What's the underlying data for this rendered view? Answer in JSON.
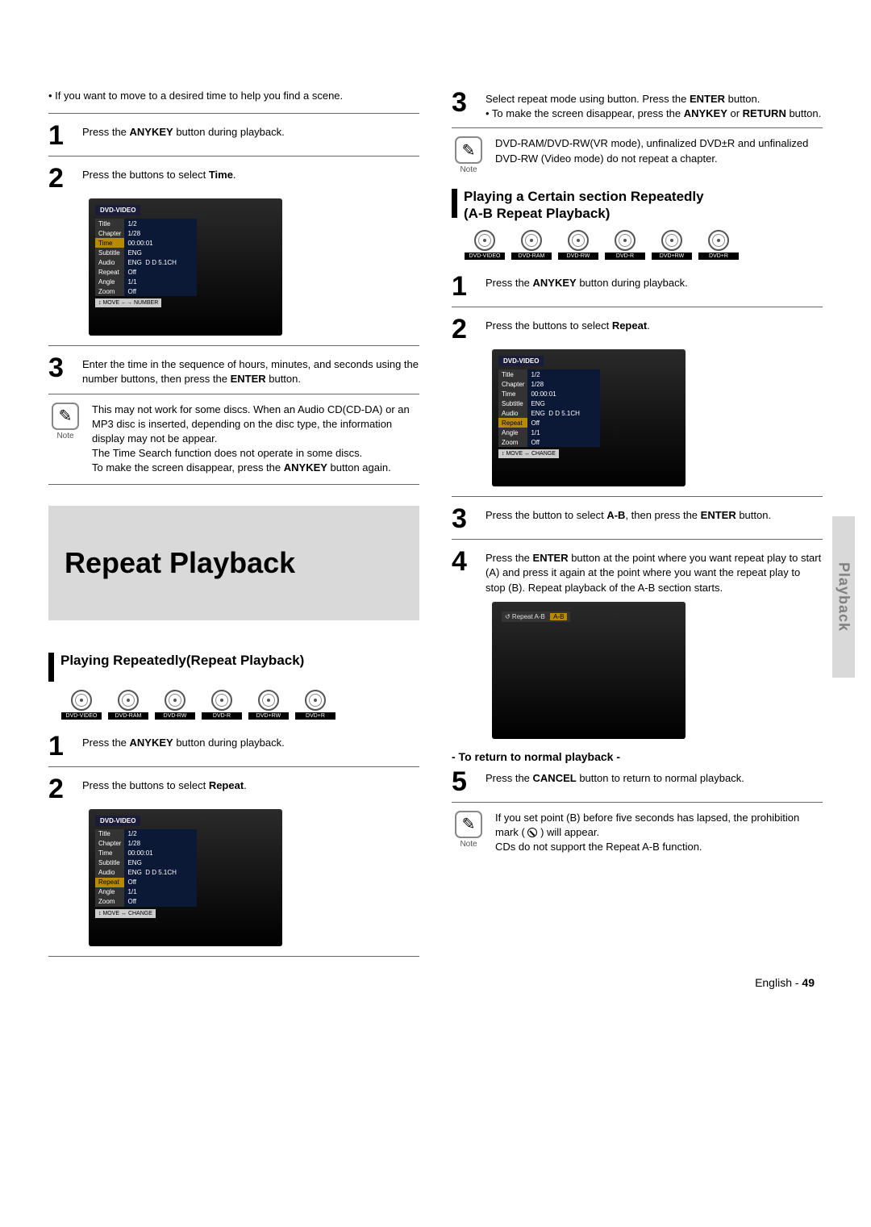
{
  "sidetab": "Playback",
  "left": {
    "intro": "• If you want to move to a desired time to help you find a scene.",
    "step1_pre": "Press the ",
    "step1_b1": "ANYKEY",
    "step1_post": " button during playback.",
    "step2_pre": "Press the          buttons to select ",
    "step2_b1": "Time",
    "step2_post": ".",
    "osd1": {
      "heading": "DVD-VIDEO",
      "rows": [
        {
          "k": "Title",
          "v": "1/2"
        },
        {
          "k": "Chapter",
          "v": "1/28"
        },
        {
          "k": "Time",
          "v": "00:00:01"
        },
        {
          "k": "Subtitle",
          "v": "ENG"
        },
        {
          "k": "Audio",
          "v": "ENG  D D 5.1CH"
        },
        {
          "k": "Repeat",
          "v": "Off"
        },
        {
          "k": "Angle",
          "v": "1/1"
        },
        {
          "k": "Zoom",
          "v": "Off"
        }
      ],
      "highlight_key": "Time",
      "foot": "↕ MOVE  ←→ NUMBER"
    },
    "step3": "Enter the time in the sequence of hours, minutes, and seconds using the number buttons, then press the ",
    "step3_b1": "ENTER",
    "step3_post": " button.",
    "note_label": "Note",
    "note1_a": "This may not work for some discs. When an Audio CD(CD-DA) or an MP3 disc is inserted, depending on the disc type, the information display may not be appear.",
    "note1_b": "The Time Search function does not operate in some discs.",
    "note1_c_pre": "To make the screen disappear, press the ",
    "note1_c_b": "ANYKEY",
    "note1_c_post": " button again.",
    "big_title": "Repeat Playback",
    "sectionA": "Playing Repeatedly(Repeat Playback)",
    "discs": [
      "DVD-VIDEO",
      "DVD-RAM",
      "DVD-RW",
      "DVD-R",
      "DVD+RW",
      "DVD+R"
    ],
    "stepA1_pre": "Press the ",
    "stepA1_b": "ANYKEY",
    "stepA1_post": " button during playback.",
    "stepA2_pre": "Press the          buttons to select ",
    "stepA2_b": "Repeat",
    "stepA2_post": ".",
    "osd2": {
      "heading": "DVD-VIDEO",
      "rows": [
        {
          "k": "Title",
          "v": "1/2"
        },
        {
          "k": "Chapter",
          "v": "1/28"
        },
        {
          "k": "Time",
          "v": "00:00:01"
        },
        {
          "k": "Subtitle",
          "v": "ENG"
        },
        {
          "k": "Audio",
          "v": "ENG  D D 5.1CH"
        },
        {
          "k": "Repeat",
          "v": "Off"
        },
        {
          "k": "Angle",
          "v": "1/1"
        },
        {
          "k": "Zoom",
          "v": "Off"
        }
      ],
      "highlight_key": "Repeat",
      "foot": "↕ MOVE  ↔ CHANGE"
    }
  },
  "right": {
    "step3_pre": "Select repeat mode using          button. Press the ",
    "step3_b1": "ENTER",
    "step3_post": " button.",
    "step3_li_pre": "• To make the screen disappear, press the ",
    "step3_li_b": "ANYKEY",
    "step3_li_mid": " or ",
    "step3_li_b2": "RETURN",
    "step3_li_post": " button.",
    "noteR1": "DVD-RAM/DVD-RW(VR mode), unfinalized DVD±R and unfinalized DVD-RW (Video mode) do not repeat a chapter.",
    "sectionB_l1": "Playing a Certain section Repeatedly",
    "sectionB_l2": "(A-B Repeat Playback)",
    "discs": [
      "DVD-VIDEO",
      "DVD-RAM",
      "DVD-RW",
      "DVD-R",
      "DVD+RW",
      "DVD+R"
    ],
    "stepB1_pre": "Press the ",
    "stepB1_b": "ANYKEY",
    "stepB1_post": " button during playback.",
    "stepB2_pre": "Press the          buttons to select ",
    "stepB2_b": "Repeat",
    "stepB2_post": ".",
    "osd3": {
      "heading": "DVD-VIDEO",
      "rows": [
        {
          "k": "Title",
          "v": "1/2"
        },
        {
          "k": "Chapter",
          "v": "1/28"
        },
        {
          "k": "Time",
          "v": "00:00:01"
        },
        {
          "k": "Subtitle",
          "v": "ENG"
        },
        {
          "k": "Audio",
          "v": "ENG  D D 5.1CH"
        },
        {
          "k": "Repeat",
          "v": "Off"
        },
        {
          "k": "Angle",
          "v": "1/1"
        },
        {
          "k": "Zoom",
          "v": "Off"
        }
      ],
      "highlight_key": "Repeat",
      "foot": "↕ MOVE  ↔ CHANGE"
    },
    "stepB3_pre": "Press the          button to select ",
    "stepB3_b": "A-B",
    "stepB3_mid": ", then press the ",
    "stepB3_b2": "ENTER",
    "stepB3_post": " button.",
    "stepB4_pre": "Press the ",
    "stepB4_b": "ENTER",
    "stepB4_mid": " button at the point where you want repeat play to start (A) and press it again at the point where you want the repeat play to stop (B). Repeat playback of the A-B section starts.",
    "osd4_label": "↺ Repeat A-B",
    "osd4_val": "A-B",
    "subhead": "- To return to normal playback -",
    "stepB5_pre": "Press the ",
    "stepB5_b": "CANCEL",
    "stepB5_post": " button to return to normal playback.",
    "noteR2_a": "If you set point (B) before five seconds has lapsed, the prohibition mark (",
    "noteR2_mid": ") will appear.",
    "noteR2_b": "CDs do not support the Repeat A-B function.",
    "note_label": "Note"
  },
  "footer_lang": "English - ",
  "footer_page": "49"
}
